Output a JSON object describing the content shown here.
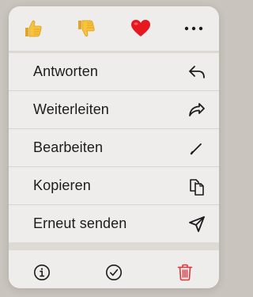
{
  "reactions": [
    {
      "name": "thumbs-up",
      "icon": "thumbs-up-icon"
    },
    {
      "name": "thumbs-down",
      "icon": "thumbs-down-icon"
    },
    {
      "name": "heart",
      "icon": "heart-icon"
    },
    {
      "name": "more",
      "icon": "more-dots-icon"
    }
  ],
  "menu_items": [
    {
      "label": "Antworten",
      "icon": "reply-icon"
    },
    {
      "label": "Weiterleiten",
      "icon": "forward-icon"
    },
    {
      "label": "Bearbeiten",
      "icon": "pencil-icon"
    },
    {
      "label": "Kopieren",
      "icon": "copy-icon"
    },
    {
      "label": "Erneut senden",
      "icon": "send-icon"
    }
  ],
  "bottom_actions": [
    {
      "name": "info",
      "icon": "info-icon"
    },
    {
      "name": "select",
      "icon": "checkmark-circle-icon"
    },
    {
      "name": "delete",
      "icon": "trash-icon"
    }
  ],
  "colors": {
    "background": "#c9c4bd",
    "menu": "#efedec",
    "destructive": "#e0353a",
    "emoji_yellow": "#f7c33a",
    "heart_red": "#e5191f"
  }
}
